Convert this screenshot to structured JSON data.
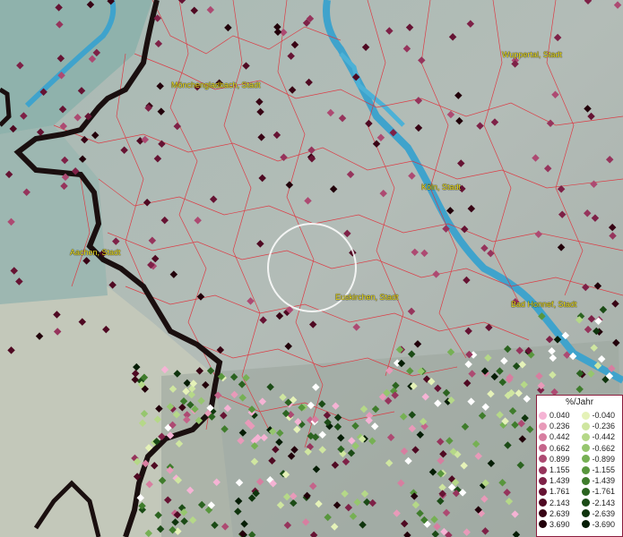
{
  "cities": [
    {
      "id": "moenchengladbach",
      "label": "Mönchengladbach, Stadt"
    },
    {
      "id": "wuppertal",
      "label": "Wuppertal, Stadt"
    },
    {
      "id": "koeln",
      "label": "Köln, Stadt"
    },
    {
      "id": "aachen",
      "label": "Aachen, Stadt"
    },
    {
      "id": "euskirchen",
      "label": "Euskirchen, Stadt"
    },
    {
      "id": "badhonnef",
      "label": "Bad Honnef, Stadt"
    }
  ],
  "legend": {
    "title": "%/Jahr",
    "positive": [
      {
        "label": "0.040",
        "color": "#f5b3d4"
      },
      {
        "label": "0.236",
        "color": "#e89ab9"
      },
      {
        "label": "0.442",
        "color": "#d77ea0"
      },
      {
        "label": "0.662",
        "color": "#c4648a"
      },
      {
        "label": "0.899",
        "color": "#ad4a72"
      },
      {
        "label": "1.155",
        "color": "#96345c"
      },
      {
        "label": "1.439",
        "color": "#7e2147"
      },
      {
        "label": "1.761",
        "color": "#661333"
      },
      {
        "label": "2.143",
        "color": "#4f0922"
      },
      {
        "label": "2.639",
        "color": "#380314"
      },
      {
        "label": "3.690",
        "color": "#22000a"
      }
    ],
    "negative": [
      {
        "label": "-0.040",
        "color": "#e5f2b8"
      },
      {
        "label": "-0.236",
        "color": "#cfe6a0"
      },
      {
        "label": "-0.442",
        "color": "#b5d888"
      },
      {
        "label": "-0.662",
        "color": "#96c66e"
      },
      {
        "label": "-0.899",
        "color": "#76b054"
      },
      {
        "label": "-1.155",
        "color": "#58963d"
      },
      {
        "label": "-1.439",
        "color": "#3f7c2c"
      },
      {
        "label": "-1.761",
        "color": "#2b6320"
      },
      {
        "label": "-2.143",
        "color": "#1b4b16"
      },
      {
        "label": "-2.639",
        "color": "#0f340d"
      },
      {
        "label": "-3.690",
        "color": "#051d05"
      }
    ]
  },
  "colors": {
    "water": "#3fa3cc",
    "border": "#1a0f0f",
    "district_lines": "#e0303a",
    "terrain": "#a9b8b1",
    "white_point": "#ffffff"
  }
}
